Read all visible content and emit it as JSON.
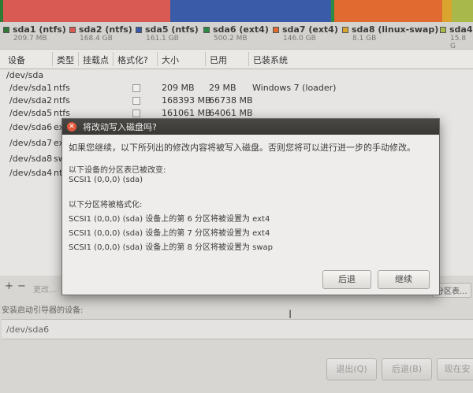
{
  "partitions": [
    {
      "name": "sda1 (ntfs)",
      "size": "209.7 MB",
      "color": "#2f7a35"
    },
    {
      "name": "sda2 (ntfs)",
      "size": "168.4 GB",
      "color": "#d85a52"
    },
    {
      "name": "sda5 (ntfs)",
      "size": "161.1 GB",
      "color": "#3a5ba8"
    },
    {
      "name": "sda6 (ext4)",
      "size": "500.2 MB",
      "color": "#2c8a45"
    },
    {
      "name": "sda7 (ext4)",
      "size": "146.0 GB",
      "color": "#e06a30"
    },
    {
      "name": "sda8 (linux-swap)",
      "size": "8.1 GB",
      "color": "#d9a52e"
    },
    {
      "name": "sda4",
      "size": "15.8 G",
      "color": "#a9b84a"
    }
  ],
  "columns": [
    "设备",
    "类型",
    "挂载点",
    "格式化?",
    "大小",
    "已用",
    "已装系统"
  ],
  "table": {
    "disk": "/dev/sda",
    "rows": [
      {
        "device": "/dev/sda1",
        "type": "ntfs",
        "size": "209 MB",
        "used": "29 MB",
        "system": "Windows 7 (loader)"
      },
      {
        "device": "/dev/sda2",
        "type": "ntfs",
        "size": "168393 MB",
        "used": "66738 MB",
        "system": ""
      },
      {
        "device": "/dev/sda5",
        "type": "ntfs",
        "size": "161061 MB",
        "used": "64061 MB",
        "system": ""
      },
      {
        "device": "/dev/sda6",
        "type": "ex",
        "size": "",
        "used": "",
        "system": ""
      },
      {
        "device": "/dev/sda7",
        "type": "ex",
        "size": "",
        "used": "",
        "system": ""
      },
      {
        "device": "/dev/sda8",
        "type": "sw",
        "size": "",
        "used": "",
        "system": ""
      },
      {
        "device": "/dev/sda4",
        "type": "nt",
        "size": "",
        "used": "",
        "system": ""
      }
    ]
  },
  "dialog": {
    "title": "将改动写入磁盘吗?",
    "message": "如果您继续，以下所列出的修改内容将被写入磁盘。否则您将可以进行进一步的手动修改。",
    "table_header": "以下设备的分区表已被改变:",
    "table_device": "SCSI1 (0,0,0) (sda)",
    "format_header": "以下分区将被格式化:",
    "format_items": [
      "SCSI1 (0,0,0) (sda) 设备上的第 6 分区将被设置为 ext4",
      "SCSI1 (0,0,0) (sda) 设备上的第 7 分区将被设置为 ext4",
      "SCSI1 (0,0,0) (sda) 设备上的第 8 分区将被设置为 swap"
    ],
    "back_label": "后退",
    "continue_label": "继续"
  },
  "toolbar": {
    "add": "+",
    "remove": "−",
    "change": "更改...",
    "new_table": "分区表..."
  },
  "boot": {
    "label": "安装启动引导器的设备:",
    "value": "/dev/sda6"
  },
  "buttons": {
    "quit": "退出(Q)",
    "back": "后退(B)",
    "install": "现在安"
  }
}
